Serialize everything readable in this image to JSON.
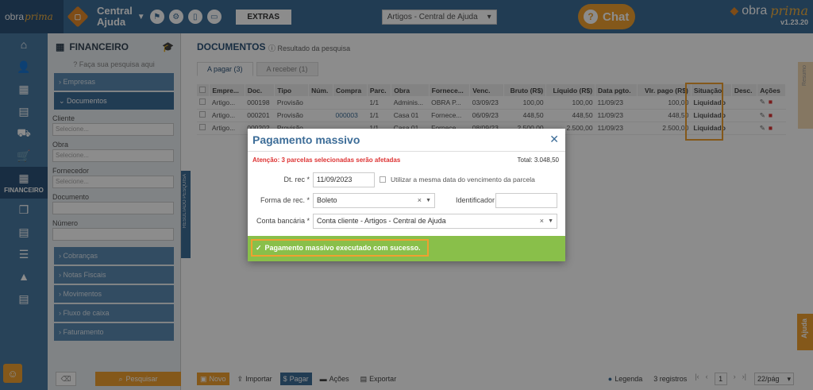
{
  "app": {
    "logo_text": "obra",
    "logo_script": "prima",
    "company_line1": "Central",
    "company_line2": "Ajuda",
    "extras_label": "EXTRAS",
    "company_select": "Artigos - Central de Ajuda",
    "chat_label": "Chat",
    "version": "v1.23.20"
  },
  "leftnav": {
    "items": [
      "home-icon",
      "user-icon",
      "building-icon",
      "document-icon",
      "truck-icon",
      "cart-icon",
      "calculator-icon",
      "boxes-icon",
      "file-icon",
      "checklist-icon",
      "chart-icon",
      "report-icon"
    ],
    "active_label": "FINANCEIRO"
  },
  "filter": {
    "title": "FINANCEIRO",
    "search_hint": "Faça sua pesquisa aqui",
    "sections_top": [
      "Empresas",
      "Documentos"
    ],
    "fields": [
      {
        "label": "Cliente",
        "placeholder": "Selecione..."
      },
      {
        "label": "Obra",
        "placeholder": "Selecione..."
      },
      {
        "label": "Fornecedor",
        "placeholder": "Selecione..."
      },
      {
        "label": "Documento",
        "placeholder": ""
      },
      {
        "label": "Número",
        "placeholder": ""
      }
    ],
    "sections_bottom": [
      "Cobranças",
      "Notas Fiscais",
      "Movimentos",
      "Fluxo de caixa",
      "Faturamento"
    ],
    "search_button": "Pesquisar",
    "side_tab": "RESULTADO PESQUISA"
  },
  "main": {
    "title": "DOCUMENTOS",
    "subtitle": "Resultado da pesquisa",
    "tabs": [
      "A pagar (3)",
      "A receber (1)"
    ],
    "columns": [
      "",
      "Empre...",
      "Doc.",
      "Tipo",
      "Núm.",
      "Compra",
      "Parc.",
      "Obra",
      "Fornece...",
      "Venc.",
      "Bruto (R$)",
      "Líquido (R$)",
      "Data pgto.",
      "Vlr. pago (R$)",
      "Situação",
      "Desc.",
      "Ações"
    ],
    "rows": [
      [
        "",
        "Artigo...",
        "000198",
        "Provisão",
        "",
        "",
        "1/1",
        "Adminis...",
        "OBRA P...",
        "03/09/23",
        "100,00",
        "100,00",
        "11/09/23",
        "100,00",
        "Liquidado",
        "",
        ""
      ],
      [
        "",
        "Artigo...",
        "000201",
        "Provisão",
        "",
        "000003",
        "1/1",
        "Casa 01",
        "Fornece...",
        "06/09/23",
        "448,50",
        "448,50",
        "11/09/23",
        "448,50",
        "Liquidado",
        "",
        ""
      ],
      [
        "",
        "Artigo...",
        "000202",
        "Provisão",
        "",
        "",
        "1/1",
        "Casa 01",
        "Fornece...",
        "08/09/23",
        "2.500,00",
        "2.500,00",
        "11/09/23",
        "2.500,00",
        "Liquidado",
        "",
        ""
      ]
    ],
    "bottom": {
      "new": "Novo",
      "import": "Importar",
      "pay": "Pagar",
      "actions": "Ações",
      "export": "Exportar",
      "legend": "Legenda",
      "records": "3 registros",
      "page": "1",
      "per_page": "22/pág"
    }
  },
  "right": {
    "resumo": "Resumo",
    "ajuda": "Ajuda"
  },
  "modal": {
    "title": "Pagamento massivo",
    "warning": "Atenção: 3 parcelas selecionadas serão afetadas",
    "total": "Total: 3.048,50",
    "dt_rec_label": "Dt. rec *",
    "dt_rec_value": "11/09/2023",
    "same_date_label": "Utilizar a mesma data do vencimento da parcela",
    "forma_label": "Forma de rec. *",
    "forma_value": "Boleto",
    "identificador_label": "Identificador",
    "identificador_value": "",
    "conta_label": "Conta bancária *",
    "conta_value": "Conta cliente - Artigos - Central de Ajuda",
    "success": "Pagamento massivo executado com sucesso."
  },
  "colors": {
    "primary": "#3d6d98",
    "accent": "#f0a030",
    "success": "#89bf4a",
    "warning_text": "#d33333"
  }
}
